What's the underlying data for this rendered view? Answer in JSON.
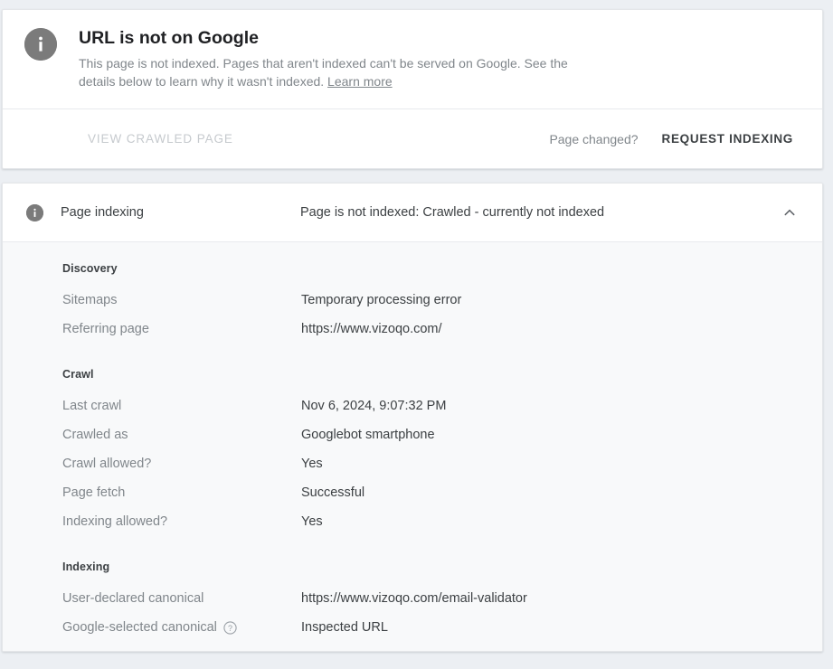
{
  "status_card": {
    "icon": "info-circle-icon",
    "title": "URL is not on Google",
    "description": "This page is not indexed. Pages that aren't indexed can't be served on Google. See the details below to learn why it wasn't indexed.",
    "learn_more_label": "Learn more",
    "view_crawled_page_label": "VIEW CRAWLED PAGE",
    "page_changed_label": "Page changed?",
    "request_indexing_label": "REQUEST INDEXING"
  },
  "detail_card": {
    "header": {
      "icon": "info-circle-icon",
      "label": "Page indexing",
      "value": "Page is not indexed: Crawled - currently not indexed",
      "toggle_icon": "chevron-up-icon"
    },
    "sections": [
      {
        "heading": "Discovery",
        "rows": [
          {
            "key": "Sitemaps",
            "value": "Temporary processing error",
            "help": false
          },
          {
            "key": "Referring page",
            "value": "https://www.vizoqo.com/",
            "help": false
          }
        ]
      },
      {
        "heading": "Crawl",
        "rows": [
          {
            "key": "Last crawl",
            "value": "Nov 6, 2024, 9:07:32 PM",
            "help": false
          },
          {
            "key": "Crawled as",
            "value": "Googlebot smartphone",
            "help": false
          },
          {
            "key": "Crawl allowed?",
            "value": "Yes",
            "help": false
          },
          {
            "key": "Page fetch",
            "value": "Successful",
            "help": false
          },
          {
            "key": "Indexing allowed?",
            "value": "Yes",
            "help": false
          }
        ]
      },
      {
        "heading": "Indexing",
        "rows": [
          {
            "key": "User-declared canonical",
            "value": "https://www.vizoqo.com/email-validator",
            "help": false
          },
          {
            "key": "Google-selected canonical",
            "value": "Inspected URL",
            "help": true
          }
        ]
      }
    ]
  },
  "colors": {
    "page_background": "#eceff3",
    "card_background": "#ffffff",
    "detail_background": "#f8f9fa",
    "icon_gray": "#7b7b7b",
    "muted_text": "#80868b",
    "primary_text": "#3c4043",
    "disabled_text": "#c6cace"
  }
}
